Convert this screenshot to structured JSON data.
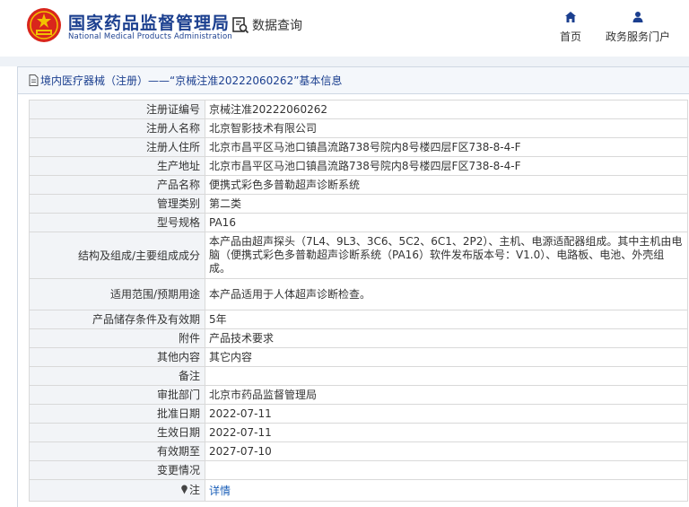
{
  "header": {
    "site_name_cn": "国家药品监督管理局",
    "site_name_en": "National Medical Products Administration",
    "query_label": "数据查询",
    "nav": [
      {
        "label": "首页",
        "icon": "home-icon"
      },
      {
        "label": "政务服务门户",
        "icon": "user-icon"
      }
    ]
  },
  "panel": {
    "title": "境内医疗器械（注册）——“京械注准20222060262”基本信息"
  },
  "rows": [
    {
      "key": "注册证编号",
      "value": "京械注准20222060262"
    },
    {
      "key": "注册人名称",
      "value": "北京智影技术有限公司"
    },
    {
      "key": "注册人住所",
      "value": "北京市昌平区马池口镇昌流路738号院内8号楼四层F区738-8-4-F"
    },
    {
      "key": "生产地址",
      "value": "北京市昌平区马池口镇昌流路738号院内8号楼四层F区738-8-4-F"
    },
    {
      "key": "产品名称",
      "value": "便携式彩色多普勒超声诊断系统"
    },
    {
      "key": "管理类别",
      "value": "第二类"
    },
    {
      "key": "型号规格",
      "value": "PA16"
    },
    {
      "key": "结构及组成/主要组成成分",
      "value": "本产品由超声探头（7L4、9L3、3C6、5C2、6C1、2P2）、主机、电源适配器组成。其中主机由电脑（便携式彩色多普勒超声诊断系统（PA16）软件发布版本号：V1.0）、电路板、电池、外壳组成。"
    },
    {
      "key": "适用范围/预期用途",
      "value": "本产品适用于人体超声诊断检查。"
    },
    {
      "key": "产品储存条件及有效期",
      "value": "5年"
    },
    {
      "key": "附件",
      "value": "产品技术要求"
    },
    {
      "key": "其他内容",
      "value": "其它内容"
    },
    {
      "key": "备注",
      "value": ""
    },
    {
      "key": "审批部门",
      "value": "北京市药品监督管理局"
    },
    {
      "key": "批准日期",
      "value": "2022-07-11"
    },
    {
      "key": "生效日期",
      "value": "2022-07-11"
    },
    {
      "key": "有效期至",
      "value": "2027-07-10"
    },
    {
      "key": "变更情况",
      "value": ""
    }
  ],
  "note_row": {
    "key": "注",
    "link": "详情"
  }
}
